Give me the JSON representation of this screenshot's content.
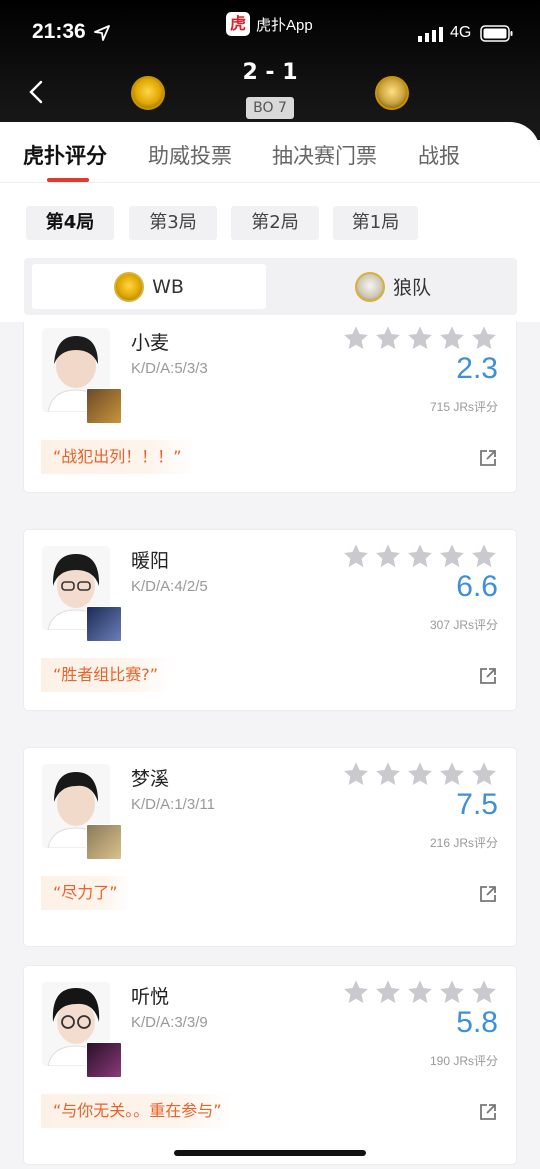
{
  "status_bar": {
    "time": "21:36",
    "app_name": "虎扑App",
    "app_icon_char": "虎",
    "network": "4G"
  },
  "match": {
    "score": "2 - 1",
    "format": "BO 7",
    "team_left_logo": "wb-logo",
    "team_right_logo": "wolves-logo"
  },
  "tabs": [
    {
      "label": "虎扑评分",
      "active": true
    },
    {
      "label": "助威投票",
      "active": false
    },
    {
      "label": "抽决赛门票",
      "active": false
    },
    {
      "label": "战报",
      "active": false
    }
  ],
  "games": [
    {
      "label": "第4局",
      "active": true
    },
    {
      "label": "第3局",
      "active": false
    },
    {
      "label": "第2局",
      "active": false
    },
    {
      "label": "第1局",
      "active": false
    }
  ],
  "teams": [
    {
      "name": "WB",
      "active": true
    },
    {
      "name": "狼队",
      "active": false
    }
  ],
  "players": [
    {
      "name": "小麦",
      "kda": "K/D/A:5/3/3",
      "rating": "2.3",
      "jrs": "715 JRs评分",
      "quote": "“战犯出列！！！”",
      "stars_filled": 0
    },
    {
      "name": "暖阳",
      "kda": "K/D/A:4/2/5",
      "rating": "6.6",
      "jrs": "307 JRs评分",
      "quote": "“胜者组比赛?”",
      "stars_filled": 0
    },
    {
      "name": "梦溪",
      "kda": "K/D/A:1/3/11",
      "rating": "7.5",
      "jrs": "216 JRs评分",
      "quote": "“尽力了”",
      "stars_filled": 0
    },
    {
      "name": "听悦",
      "kda": "K/D/A:3/3/9",
      "rating": "5.8",
      "jrs": "190 JRs评分",
      "quote": "“与你无关。。重在参与”",
      "stars_filled": 0
    }
  ],
  "colors": {
    "accent_red": "#e03a2f",
    "rating_blue": "#3d8fd8",
    "quote_orange": "#e8632b",
    "star_grey": "#c9c9cf"
  }
}
